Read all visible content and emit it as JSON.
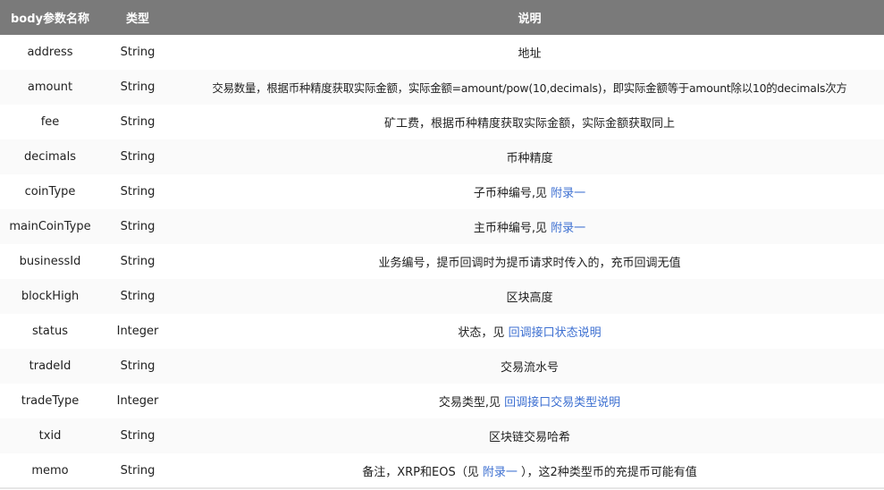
{
  "table": {
    "headers": {
      "name": "body参数名称",
      "type": "类型",
      "desc": "说明"
    },
    "rows": [
      {
        "name": "address",
        "type": "String",
        "desc": "地址"
      },
      {
        "name": "amount",
        "type": "String",
        "desc": "交易数量，根据币种精度获取实际金额，实际金额=amount/pow(10,decimals)，即实际金额等于amount除以10的decimals次方"
      },
      {
        "name": "fee",
        "type": "String",
        "desc": "矿工费，根据币种精度获取实际金额，实际金额获取同上"
      },
      {
        "name": "decimals",
        "type": "String",
        "desc": "币种精度"
      },
      {
        "name": "coinType",
        "type": "String",
        "desc": "子币种编号,见 ",
        "link": "附录一"
      },
      {
        "name": "mainCoinType",
        "type": "String",
        "desc": "主币种编号,见 ",
        "link": "附录一"
      },
      {
        "name": "businessId",
        "type": "String",
        "desc": "业务编号，提币回调时为提币请求时传入的，充币回调无值"
      },
      {
        "name": "blockHigh",
        "type": "String",
        "desc": "区块高度"
      },
      {
        "name": "status",
        "type": "Integer",
        "desc": "状态，见 ",
        "link": "回调接口状态说明"
      },
      {
        "name": "tradeId",
        "type": "String",
        "desc": "交易流水号"
      },
      {
        "name": "tradeType",
        "type": "Integer",
        "desc": "交易类型,见 ",
        "link": "回调接口交易类型说明"
      },
      {
        "name": "txid",
        "type": "String",
        "desc": "区块链交易哈希"
      },
      {
        "name": "memo",
        "type": "String",
        "desc": "备注，XRP和EOS（见 ",
        "link": "附录一",
        "desc_after": " ），这2种类型币的充提币可能有值"
      }
    ]
  },
  "colors": {
    "header_bg": "#7a7a7a",
    "header_text": "#ffffff",
    "link": "#3c6fd1",
    "body_text": "#222222"
  }
}
